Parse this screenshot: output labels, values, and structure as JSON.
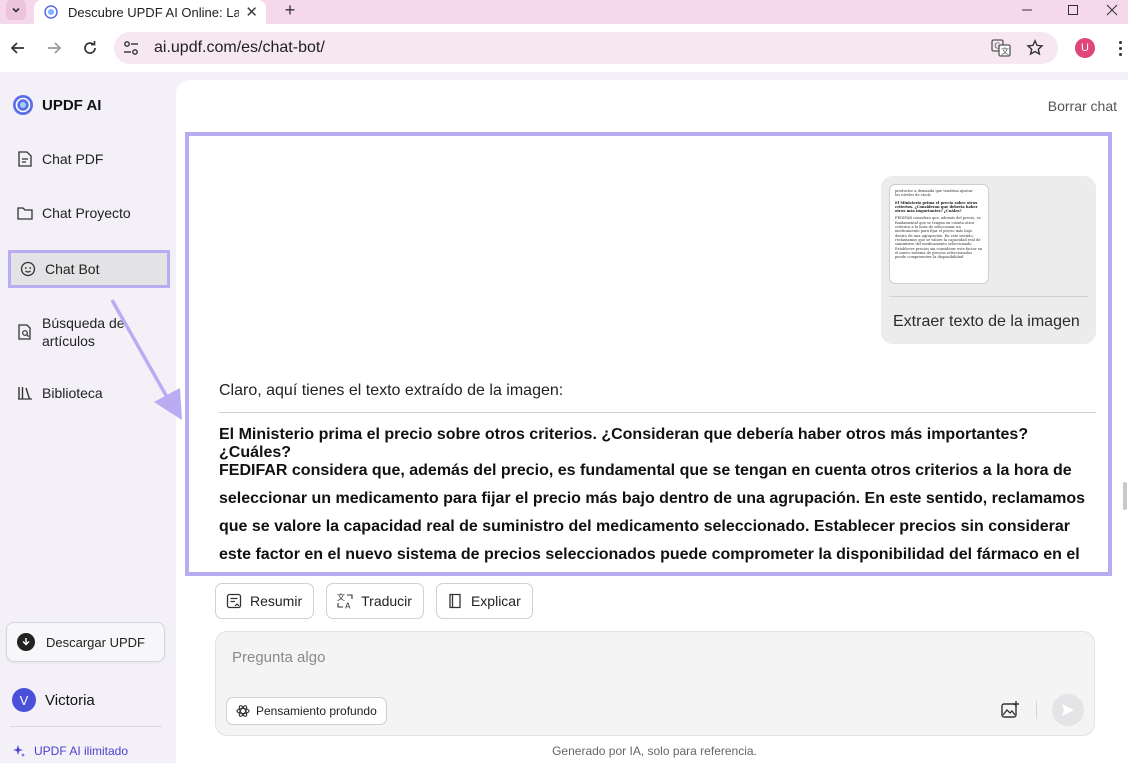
{
  "browser": {
    "tab_title": "Descubre UPDF AI Online: La",
    "url": "ai.updf.com/es/chat-bot/",
    "profile_initial": "U"
  },
  "sidebar": {
    "brand": "UPDF AI",
    "items": [
      {
        "label": "Chat PDF",
        "icon": "chat-pdf-icon"
      },
      {
        "label": "Chat Proyecto",
        "icon": "folder-icon"
      },
      {
        "label": "Chat Bot",
        "icon": "bot-icon",
        "active": true
      },
      {
        "label_line1": "Búsqueda de",
        "label_line2": "artículos",
        "icon": "search-document-icon"
      },
      {
        "label": "Biblioteca",
        "icon": "library-icon"
      }
    ],
    "download_label": "Descargar UPDF",
    "user_initial": "V",
    "user_name": "Victoria",
    "unlimited_label": "UPDF AI ilimitado"
  },
  "main": {
    "clear_chat": "Borrar chat",
    "user_message": {
      "attachment_caption": "Extraer texto de la imagen",
      "thumbnail_lines": [
        "productor a demanda que tendrían ajustar",
        "los niveles de stock.",
        "El Ministerio prima el precio sobre otros criterios. ¿Consideran que debería haber otros más importantes? ¿Cuáles?",
        "FEDIFAR considera que, además del precio, es fundamental que se tengan en cuenta otros criterios a la hora de seleccionar un medicamento para fijar el precio más bajo dentro de una agrupación. En este sentido, reclamamos que se valore la capacidad real de suministro del medicamento seleccionado. Establecer precios sin considerar este factor en el nuevo sistema de precios seleccionados puede comprometer la disponibilidad"
      ]
    },
    "assistant": {
      "intro": "Claro, aquí tienes el texto extraído de la imagen:",
      "question": "El Ministerio prima el precio sobre otros criterios. ¿Consideran que debería haber otros más importantes? ¿Cuáles?",
      "body": "FEDIFAR considera que, además del precio, es fundamental que se tengan en cuenta otros criterios a la hora de seleccionar un medicamento para fijar el precio más bajo dentro de una agrupación. En este sentido, reclamamos que se valore la capacidad real de suministro del medicamento seleccionado. Establecer precios sin considerar este factor en el nuevo sistema de precios seleccionados puede comprometer la disponibilidad del fármaco en el canal"
    },
    "actions": {
      "summarize": "Resumir",
      "translate": "Traducir",
      "explain": "Explicar"
    },
    "composer": {
      "placeholder": "Pregunta algo",
      "deep_think": "Pensamiento profundo"
    },
    "footnote": "Generado por IA, solo para referencia."
  },
  "colors": {
    "highlight": "#b9acf2",
    "accent": "#4a3fcf",
    "tabbar": "#f6d8ec"
  }
}
